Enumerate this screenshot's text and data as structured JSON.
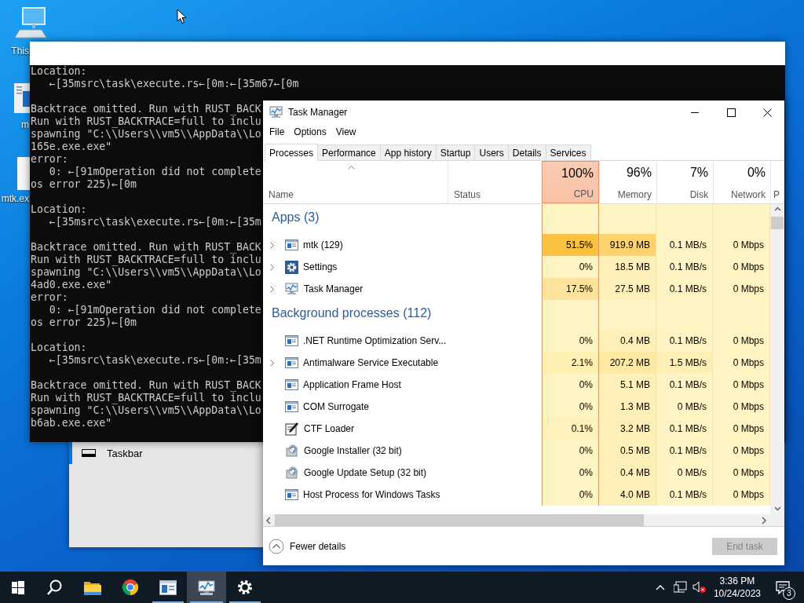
{
  "desktop_icons": [
    {
      "label": "This",
      "kind": "pc"
    },
    {
      "label": "m",
      "kind": "document"
    },
    {
      "label": "mtk.ex",
      "kind": "blank"
    }
  ],
  "settings_window": {
    "items": [
      {
        "label": "Taskbar",
        "selected": true
      }
    ]
  },
  "console": {
    "blocks": [
      [
        "Location:",
        "   ←[35msrc\\task\\execute.rs←[0m:←[35m67←[0m"
      ],
      [
        "Backtrace omitted. Run with RUST_BACK",
        "Run with RUST_BACKTRACE=full to inclu",
        "spawning \"C:\\\\Users\\\\vm5\\\\AppData\\\\Lo",
        "165e.exe.exe\"",
        "error:",
        "   0: ←[91mOperation did not complete",
        "os error 225)←[0m"
      ],
      [
        "Location:",
        "   ←[35msrc\\task\\execute.rs←[0m:←[35m"
      ],
      [
        "Backtrace omitted. Run with RUST_BACK",
        "Run with RUST_BACKTRACE=full to inclu",
        "spawning \"C:\\\\Users\\\\vm5\\\\AppData\\\\Lo",
        "4ad0.exe.exe\"",
        "error:",
        "   0: ←[91mOperation did not complete",
        "os error 225)←[0m"
      ],
      [
        "Location:",
        "   ←[35msrc\\task\\execute.rs←[0m:←[35m"
      ],
      [
        "Backtrace omitted. Run with RUST_BACK",
        "Run with RUST_BACKTRACE=full to inclu",
        "spawning \"C:\\\\Users\\\\vm5\\\\AppData\\\\Lo",
        "b6ab.exe.exe\""
      ]
    ]
  },
  "task_manager": {
    "title": "Task Manager",
    "menu": [
      "File",
      "Options",
      "View"
    ],
    "tabs": [
      {
        "label": "Processes",
        "selected": true
      },
      {
        "label": "Performance",
        "selected": false
      },
      {
        "label": "App history",
        "selected": false
      },
      {
        "label": "Startup",
        "selected": false
      },
      {
        "label": "Users",
        "selected": false
      },
      {
        "label": "Details",
        "selected": false
      },
      {
        "label": "Services",
        "selected": false
      }
    ],
    "columns": [
      {
        "kind": "text",
        "label": "Name",
        "sorted": true
      },
      {
        "kind": "text",
        "label": "Status",
        "sorted": false
      },
      {
        "kind": "metric",
        "value": "100%",
        "label": "CPU",
        "highlighted": true
      },
      {
        "kind": "metric",
        "value": "96%",
        "label": "Memory",
        "highlighted": false
      },
      {
        "kind": "metric",
        "value": "7%",
        "label": "Disk",
        "highlighted": false
      },
      {
        "kind": "metric",
        "value": "0%",
        "label": "Network",
        "highlighted": false
      },
      {
        "kind": "cut",
        "label": "P"
      }
    ],
    "groups": [
      {
        "title": "Apps (3)",
        "rows": [
          {
            "name": "mtk (129)",
            "kind": "window",
            "expandable": true,
            "cells": [
              {
                "text": "51.5%",
                "color": "#fbc241"
              },
              {
                "text": "919.9 MB",
                "color": "#fdd26f"
              },
              {
                "text": "0.1 MB/s",
                "color": "#fff4c4"
              },
              {
                "text": "0 Mbps",
                "color": "#fff4c4"
              }
            ]
          },
          {
            "name": "Settings",
            "kind": "gear",
            "expandable": true,
            "cells": [
              {
                "text": "0%",
                "color": "#fff4c4"
              },
              {
                "text": "18.5 MB",
                "color": "#fff0b9"
              },
              {
                "text": "0.1 MB/s",
                "color": "#fff4c4"
              },
              {
                "text": "0 Mbps",
                "color": "#fff4c4"
              }
            ]
          },
          {
            "name": "Task Manager",
            "kind": "monitor",
            "expandable": true,
            "cells": [
              {
                "text": "17.5%",
                "color": "#fee39a"
              },
              {
                "text": "27.5 MB",
                "color": "#fff0b9"
              },
              {
                "text": "0.1 MB/s",
                "color": "#fff4c4"
              },
              {
                "text": "0 Mbps",
                "color": "#fff4c4"
              }
            ]
          }
        ]
      },
      {
        "title": "Background processes (112)",
        "rows": [
          {
            "name": ".NET Runtime Optimization Serv...",
            "kind": "window",
            "expandable": false,
            "cells": [
              {
                "text": "0%",
                "color": "#fff4c4"
              },
              {
                "text": "0.4 MB",
                "color": "#fff0b9"
              },
              {
                "text": "0.1 MB/s",
                "color": "#fff4c4"
              },
              {
                "text": "0 Mbps",
                "color": "#fff4c4"
              }
            ]
          },
          {
            "name": "Antimalware Service Executable",
            "kind": "window",
            "expandable": true,
            "cells": [
              {
                "text": "2.1%",
                "color": "#ffefb3"
              },
              {
                "text": "207.2 MB",
                "color": "#ffe9a3"
              },
              {
                "text": "1.5 MB/s",
                "color": "#ffefb5"
              },
              {
                "text": "0 Mbps",
                "color": "#fff4c4"
              }
            ]
          },
          {
            "name": "Application Frame Host",
            "kind": "window",
            "expandable": false,
            "cells": [
              {
                "text": "0%",
                "color": "#fff4c4"
              },
              {
                "text": "5.1 MB",
                "color": "#fff0b9"
              },
              {
                "text": "0.1 MB/s",
                "color": "#fff4c4"
              },
              {
                "text": "0 Mbps",
                "color": "#fff4c4"
              }
            ]
          },
          {
            "name": "COM Surrogate",
            "kind": "window",
            "expandable": false,
            "cells": [
              {
                "text": "0%",
                "color": "#fff4c4"
              },
              {
                "text": "1.3 MB",
                "color": "#fff0b9"
              },
              {
                "text": "0 MB/s",
                "color": "#fff4c4"
              },
              {
                "text": "0 Mbps",
                "color": "#fff4c4"
              }
            ]
          },
          {
            "name": "CTF Loader",
            "kind": "pen",
            "expandable": false,
            "cells": [
              {
                "text": "0.1%",
                "color": "#fff1bb"
              },
              {
                "text": "3.2 MB",
                "color": "#fff0b9"
              },
              {
                "text": "0.1 MB/s",
                "color": "#fff4c4"
              },
              {
                "text": "0 Mbps",
                "color": "#fff4c4"
              }
            ]
          },
          {
            "name": "Google Installer (32 bit)",
            "kind": "installer",
            "expandable": false,
            "cells": [
              {
                "text": "0%",
                "color": "#fff4c4"
              },
              {
                "text": "0.5 MB",
                "color": "#fff0b9"
              },
              {
                "text": "0.1 MB/s",
                "color": "#fff4c4"
              },
              {
                "text": "0 Mbps",
                "color": "#fff4c4"
              }
            ]
          },
          {
            "name": "Google Update Setup (32 bit)",
            "kind": "installer",
            "expandable": false,
            "cells": [
              {
                "text": "0%",
                "color": "#fff4c4"
              },
              {
                "text": "0.4 MB",
                "color": "#fff0b9"
              },
              {
                "text": "0 MB/s",
                "color": "#fff4c4"
              },
              {
                "text": "0 Mbps",
                "color": "#fff4c4"
              }
            ]
          },
          {
            "name": "Host Process for Windows Tasks",
            "kind": "window",
            "expandable": false,
            "cells": [
              {
                "text": "0%",
                "color": "#fff4c4"
              },
              {
                "text": "4.0 MB",
                "color": "#fff0b9"
              },
              {
                "text": "0.1 MB/s",
                "color": "#fff4c4"
              },
              {
                "text": "0 Mbps",
                "color": "#fff4c4"
              }
            ]
          }
        ]
      }
    ],
    "footer": {
      "toggle": "Fewer details",
      "button": {
        "label": "End task",
        "disabled": true
      }
    }
  },
  "taskbar": {
    "apps": [
      {
        "kind": "start",
        "running": false,
        "active": false
      },
      {
        "kind": "search",
        "running": false,
        "active": false
      },
      {
        "kind": "folder",
        "running": false,
        "active": false
      },
      {
        "kind": "browser",
        "running": false,
        "active": false
      },
      {
        "kind": "app",
        "running": true,
        "active": false
      },
      {
        "kind": "monitor",
        "running": true,
        "active": true
      },
      {
        "kind": "gear",
        "running": true,
        "active": false
      }
    ],
    "tray": {
      "time": "3:36 PM",
      "date": "10/24/2023",
      "notification_count": "3"
    }
  }
}
